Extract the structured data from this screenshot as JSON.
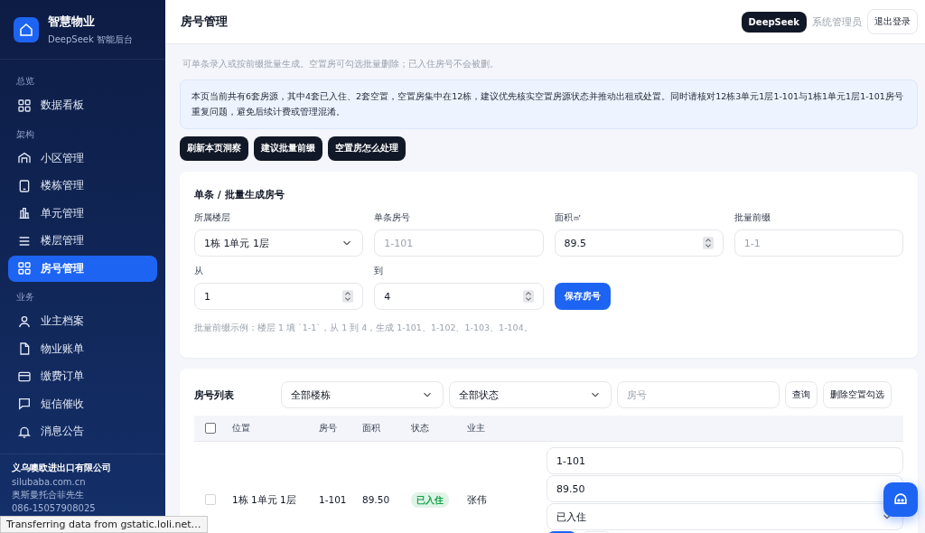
{
  "sidebar": {
    "brand": {
      "title": "智慧物业",
      "subtitle": "DeepSeek 智能后台"
    },
    "sections": [
      {
        "heading": "总览",
        "items": [
          {
            "label": "数据看板",
            "kind": "grid",
            "selected": false
          }
        ]
      },
      {
        "heading": "架构",
        "items": [
          {
            "label": "小区管理",
            "kind": "home",
            "selected": false
          },
          {
            "label": "楼栋管理",
            "kind": "tablet",
            "selected": false
          },
          {
            "label": "单元管理",
            "kind": "chart",
            "selected": false
          },
          {
            "label": "楼层管理",
            "kind": "list",
            "selected": false
          },
          {
            "label": "房号管理",
            "kind": "grid",
            "selected": true
          }
        ]
      },
      {
        "heading": "业务",
        "items": [
          {
            "label": "业主档案",
            "kind": "user",
            "selected": false
          },
          {
            "label": "物业账单",
            "kind": "file",
            "selected": false
          },
          {
            "label": "缴费订单",
            "kind": "card",
            "selected": false
          },
          {
            "label": "短信催收",
            "kind": "chat",
            "selected": false
          },
          {
            "label": "消息公告",
            "kind": "bell",
            "selected": false
          }
        ]
      }
    ],
    "footer": {
      "company": "义乌噢欧进出口有限公司",
      "lines": [
        "silubaba.com.cn",
        "奥斯曼托合菲先生",
        "086-15057908025"
      ]
    }
  },
  "header": {
    "title": "房号管理",
    "badge": "DeepSeek",
    "user": "系统管理员",
    "logout": "退出登录"
  },
  "intro": "可单条录入或按前缀批量生成。空置房可勾选批量删除；已入住房号不会被删。",
  "insight": "本页当前共有6套房源，其中4套已入住、2套空置，空置房集中在12栋，建议优先核实空置房源状态并推动出租或处置。同时请核对12栋3单元1层1-101与1栋1单元1层1-101房号重复问题，避免后续计费或管理混淆。",
  "ai_buttons": [
    "刷新本页洞察",
    "建议批量前缀",
    "空置房怎么处理"
  ],
  "form": {
    "title": "单条 / 批量生成房号",
    "fields": [
      {
        "label": "所属楼层",
        "kind": "select",
        "value": "1栋 1单元 1层"
      },
      {
        "label": "单条房号",
        "kind": "text",
        "placeholder": "1-101"
      },
      {
        "label": "面积㎡",
        "kind": "number",
        "value": "89.5"
      },
      {
        "label": "批量前缀",
        "kind": "text",
        "placeholder": "1-1"
      },
      {
        "label": "从",
        "kind": "number",
        "value": "1"
      },
      {
        "label": "到",
        "kind": "number",
        "value": "4"
      }
    ],
    "save": "保存房号",
    "hint": "批量前缀示例：楼层 1 填 `1-1`，从 1 到 4，生成 1-101、1-102、1-103、1-104。"
  },
  "list": {
    "title": "房号列表",
    "filters": [
      {
        "kind": "select",
        "value": "全部楼栋"
      },
      {
        "kind": "select",
        "value": "全部状态"
      },
      {
        "kind": "text",
        "placeholder": "房号"
      }
    ],
    "buttons": [
      "查询",
      "删除空置勾选"
    ],
    "header_checked": false,
    "columns": [
      "位置",
      "房号",
      "面积",
      "状态",
      "业主"
    ],
    "rows": [
      {
        "checked": false,
        "location": "1栋 1单元 1层",
        "room": "1-101",
        "area": "89.50",
        "status": "已入住",
        "color": "#16a34a",
        "owner": "张伟",
        "edit": {
          "room": "1-101",
          "area": "89.50",
          "status": "已入住"
        }
      }
    ]
  },
  "status_bar": "Transferring data from gstatic.loli.net…"
}
